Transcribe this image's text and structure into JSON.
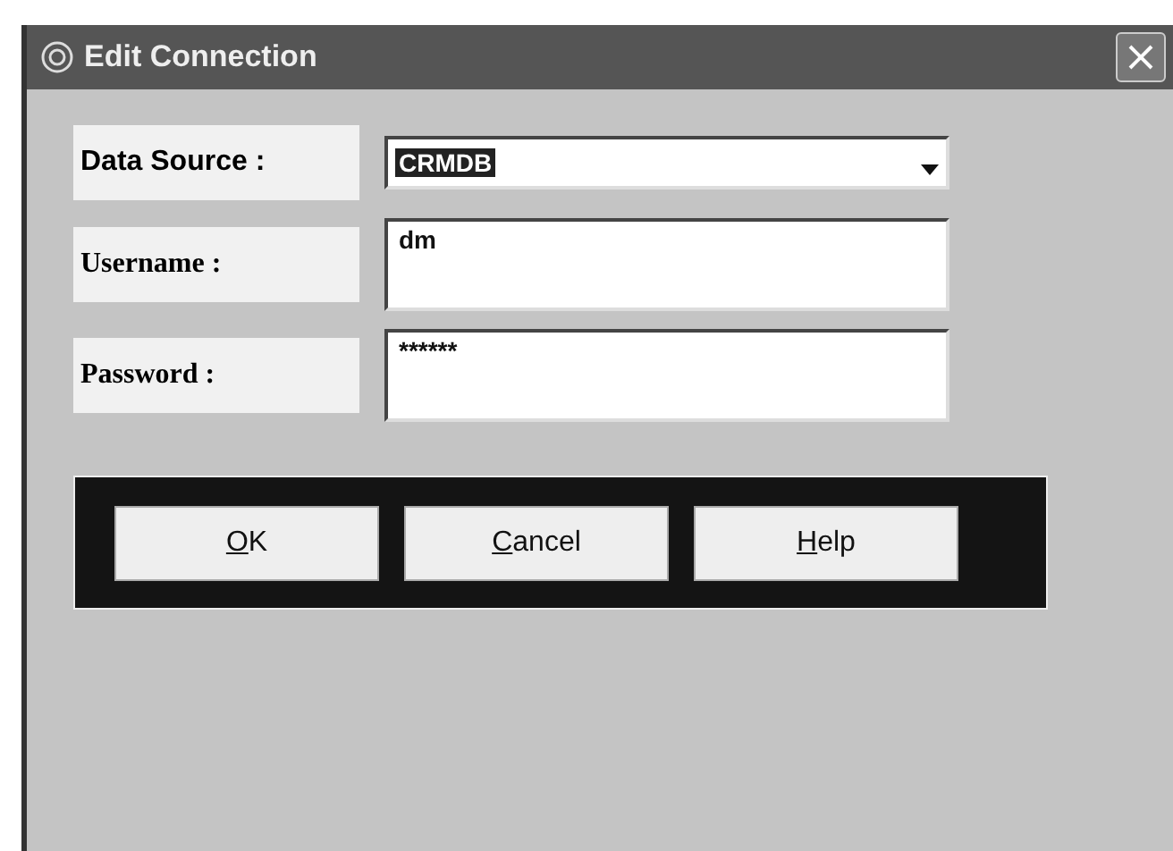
{
  "window": {
    "title": "Edit Connection"
  },
  "fields": [
    {
      "kind": "dropdown",
      "label": "Data Source :",
      "value": "CRMDB",
      "selected": true
    },
    {
      "kind": "text",
      "label": "Username :",
      "value": "dm",
      "selected": false
    },
    {
      "kind": "text",
      "label": "Password :",
      "value": "******",
      "selected": false
    }
  ],
  "buttons": [
    {
      "label": "OK"
    },
    {
      "label": "Cancel"
    },
    {
      "label": "Help"
    }
  ]
}
